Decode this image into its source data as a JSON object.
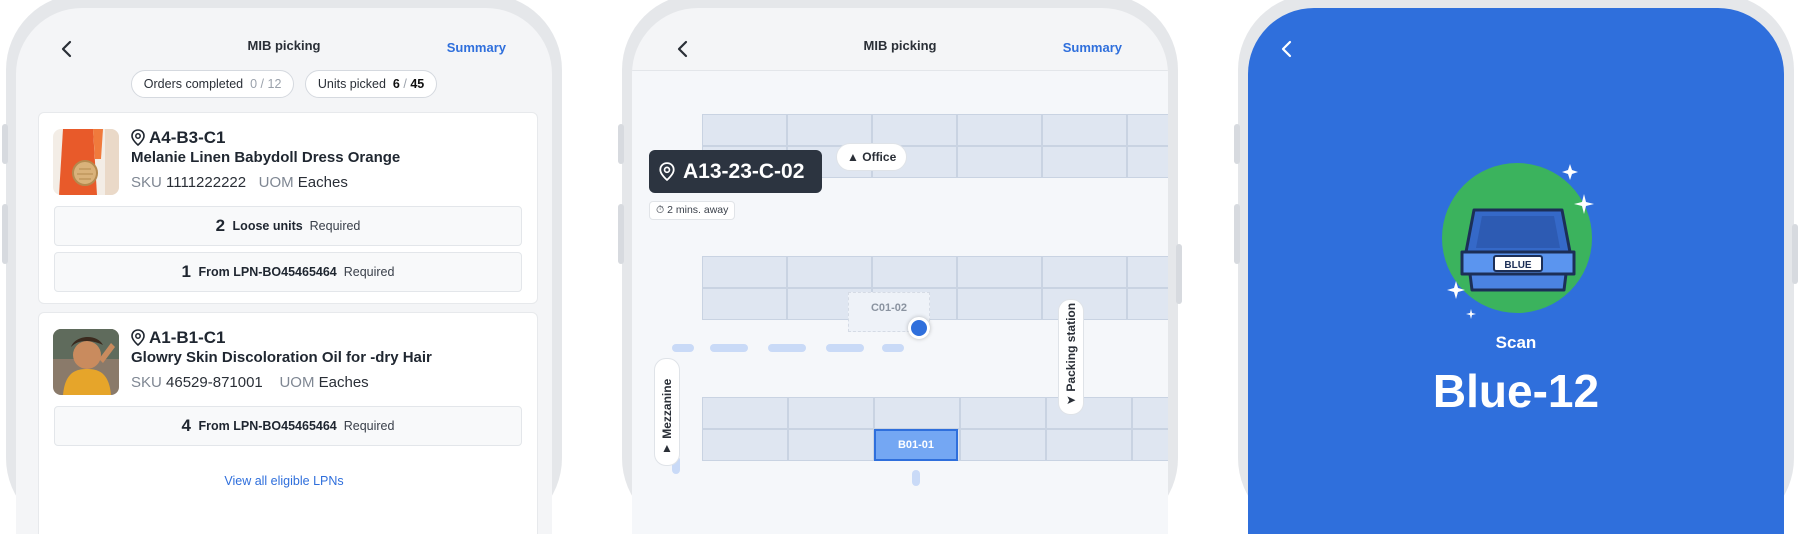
{
  "phone1": {
    "title": "MIB picking",
    "summary": "Summary",
    "chips": {
      "orders_label": "Orders completed",
      "orders_done": "0",
      "orders_total": "12",
      "units_label": "Units picked",
      "units_done": "6",
      "units_total": "45"
    },
    "items": [
      {
        "location": "A4-B3-C1",
        "name": "Melanie Linen Babydoll Dress Orange",
        "sku_label": "SKU",
        "sku": "1111222222",
        "uom_label": "UOM",
        "uom": "Eaches",
        "requirements": [
          {
            "count": "2",
            "label": "Loose units",
            "status": "Required"
          },
          {
            "count": "1",
            "label": "From LPN-BO45465464",
            "status": "Required"
          }
        ]
      },
      {
        "location": "A1-B1-C1",
        "name": "Glowry Skin Discoloration Oil for -dry Hair",
        "sku_label": "SKU",
        "sku": "46529-871001",
        "uom_label": "UOM",
        "uom": "Eaches",
        "requirements": [
          {
            "count": "4",
            "label": "From LPN-BO45465464",
            "status": "Required"
          }
        ]
      }
    ],
    "view_all": "View all eligible LPNs",
    "sep": "/"
  },
  "phone2": {
    "title": "MIB picking",
    "summary": "Summary",
    "location": "A13-23-C-02",
    "away": "2 mins. away",
    "office": "Office",
    "bin_c": "C01-02",
    "bin_b": "B01-01",
    "mezzanine": "Mezzanine",
    "packing": "Packing station"
  },
  "phone3": {
    "tote_label": "BLUE",
    "scan_label": "Scan",
    "scan_value": "Blue-12"
  },
  "colors": {
    "accent": "#2f6fdc",
    "success": "#3bb35d",
    "dark": "#2c3440"
  }
}
